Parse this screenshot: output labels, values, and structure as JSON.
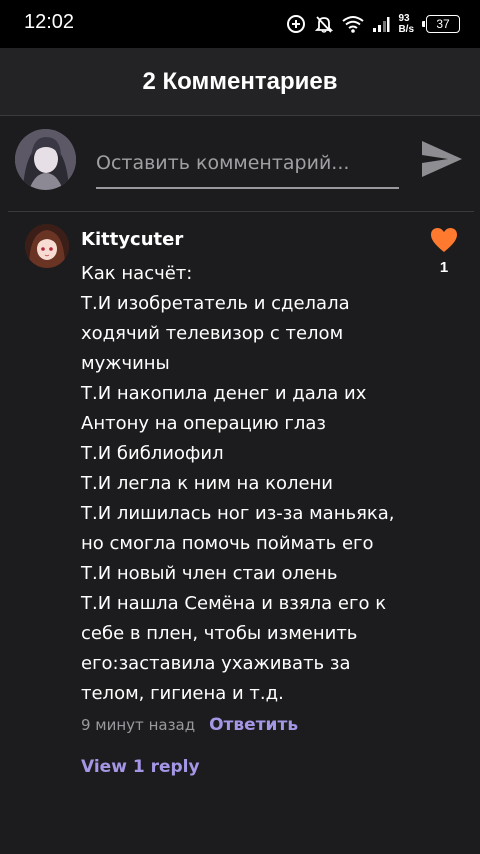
{
  "status_bar": {
    "time": "12:02",
    "net_speed_value": "93",
    "net_speed_unit": "B/s",
    "battery": "37",
    "icons": [
      "data-saver-icon",
      "muted-bell-icon",
      "wifi-icon",
      "signal-icon",
      "battery-icon"
    ]
  },
  "header": {
    "title": "2 Комментариев"
  },
  "comment_input": {
    "placeholder": "Оставить комментарий...",
    "value": "",
    "send_icon": "send-icon"
  },
  "comments": [
    {
      "username": "Kittycuter",
      "body": "Как насчёт:\nТ.И изобретатель и сделала ходячий телевизор с телом мужчины\nТ.И накопила денег и дала их Антону на операцию глаз\nТ.И библиофил\nТ.И легла к ним на колени\nТ.И лишилась ног из-за маньяка, но смогла помочь поймать его\nТ.И новый член стаи олень\nТ.И нашла Семёна и взяла его к себе в плен, чтобы изменить его:заставила ухаживать за телом, гигиена и т.д.",
      "time_ago": "9 минут назад",
      "reply_label": "Ответить",
      "likes": "1",
      "view_replies_label": "View 1 reply"
    }
  ],
  "colors": {
    "background": "#1c1c1e",
    "header": "#232325",
    "accent": "#a696e6",
    "like": "#ff7a2e"
  }
}
